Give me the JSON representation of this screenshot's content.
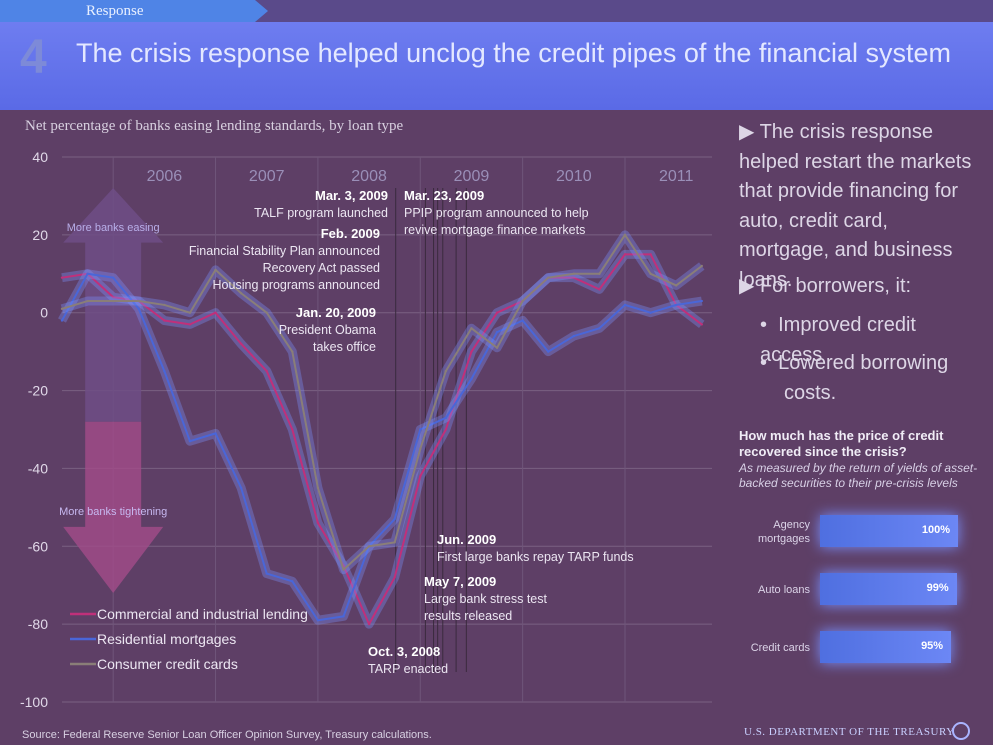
{
  "nav": {
    "steps": [
      "Response",
      "",
      "",
      "",
      ""
    ]
  },
  "header": {
    "section_number": "4",
    "title": "The crisis response helped unclog the credit pipes of the financial system"
  },
  "colors": {
    "commercial": "#c0307a",
    "residential": "#4a66d8",
    "consumer": "#8a7e78",
    "accent": "#4f84e6"
  },
  "chart_data": {
    "type": "line",
    "title": "Net percentage of banks easing lending standards, by loan type",
    "ylim": [
      -100,
      40
    ],
    "yticks": [
      "40",
      "20",
      "0",
      "-20",
      "-40",
      "-60",
      "-80",
      "-100"
    ],
    "year_labels": [
      "2006",
      "2007",
      "2008",
      "2009",
      "2010",
      "2011"
    ],
    "x": [
      2005.5,
      2005.75,
      2006,
      2006.25,
      2006.5,
      2006.75,
      2007,
      2007.25,
      2007.5,
      2007.75,
      2008,
      2008.25,
      2008.5,
      2008.75,
      2009,
      2009.25,
      2009.5,
      2009.75,
      2010,
      2010.25,
      2010.5,
      2010.75,
      2011,
      2011.25,
      2011.5,
      2011.75
    ],
    "series": [
      {
        "name": "Commercial and industrial lending",
        "color": "#c0307a",
        "values": [
          9,
          10,
          4,
          3,
          -2,
          -3,
          0,
          -8,
          -15,
          -30,
          -54,
          -65,
          -80,
          -68,
          -42,
          -30,
          -10,
          0,
          3,
          9,
          9,
          6,
          15,
          15,
          2,
          -3
        ]
      },
      {
        "name": "Residential mortgages",
        "color": "#4a66d8",
        "values": [
          -2,
          10,
          9,
          1,
          -15,
          -33,
          -31,
          -45,
          -67,
          -69,
          -79,
          -78,
          -60,
          -53,
          -30,
          -27,
          -17,
          -5,
          -2,
          -10,
          -6,
          -4,
          2,
          0,
          2,
          3
        ]
      },
      {
        "name": "Consumer credit cards",
        "color": "#8a7e78",
        "values": [
          1,
          3,
          3,
          3,
          2,
          0,
          11,
          5,
          0,
          -10,
          -45,
          -66,
          -60,
          -59,
          -35,
          -15,
          -4,
          -9,
          3,
          9,
          10,
          10,
          20,
          10,
          7,
          12
        ]
      }
    ],
    "legend": "bottom-left",
    "annotations": [
      {
        "date": "Mar. 3, 2009",
        "text": "TALF program launched"
      },
      {
        "date": "Feb. 2009",
        "text": "Financial Stability Plan announced\nRecovery Act passed\nHousing programs announced"
      },
      {
        "date": "Jan. 20, 2009",
        "text": "President Obama\ntakes office"
      },
      {
        "date": "Mar. 23, 2009",
        "text": "PPIP program announced to help\nrevive mortgage finance markets"
      },
      {
        "date": "Jun. 2009",
        "text": "First large banks repay TARP funds"
      },
      {
        "date": "May 7, 2009",
        "text": "Large bank stress test\nresults released"
      },
      {
        "date": "Oct. 3, 2008",
        "text": "TARP enacted"
      }
    ],
    "arrow_up_label": "More banks easing",
    "arrow_down_label": "More banks tightening"
  },
  "sidebar": {
    "bullets": [
      "The crisis response helped restart the markets that provide financing for auto, credit card, mortgage, and business loans.",
      "For borrowers, it:"
    ],
    "sub_bullets": [
      "Improved credit access",
      "Lowered borrowing costs."
    ],
    "question_title": "How much has the price of credit recovered since the crisis?",
    "question_subtitle": "As measured by the return of yields of asset-backed securities to their pre-crisis levels"
  },
  "recovery_chart": {
    "type": "bar",
    "categories": [
      "Agency mortgages",
      "Auto loans",
      "Credit cards"
    ],
    "values": [
      100,
      99,
      95
    ],
    "labels": [
      "100%",
      "99%",
      "95%"
    ]
  },
  "footer": {
    "source": "Source: Federal Reserve Senior Loan Officer Opinion Survey, Treasury calculations.",
    "logo_text": "U.S. DEPARTMENT OF THE TREASURY"
  }
}
